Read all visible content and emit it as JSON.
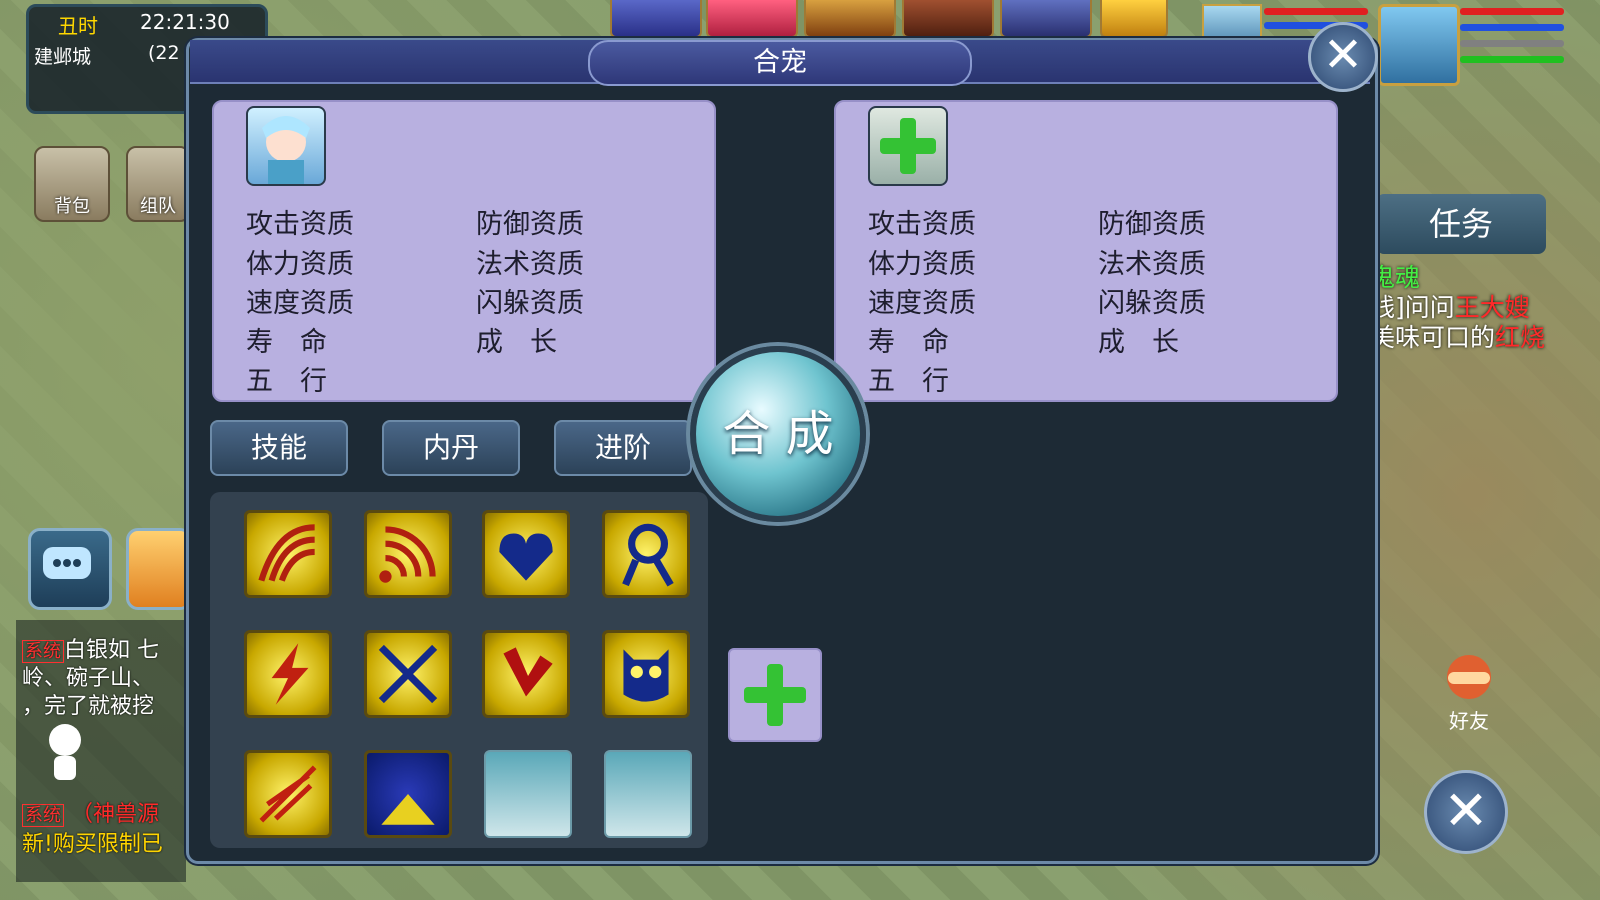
{
  "status": {
    "shichen": "丑时",
    "clock": "22:21:30",
    "city": "建邺城",
    "coord": "(22"
  },
  "side_buttons": {
    "bag": "背包",
    "team": "组队"
  },
  "panel": {
    "title": "合宠",
    "left_attrs": [
      "攻击资质",
      "防御资质",
      "体力资质",
      "法术资质",
      "速度资质",
      "闪躲资质",
      "寿　命",
      "成　长",
      "五　行"
    ],
    "right_attrs": [
      "攻击资质",
      "防御资质",
      "体力资质",
      "法术资质",
      "速度资质",
      "闪躲资质",
      "寿　命",
      "成　长",
      "五　行"
    ],
    "tabs": [
      "技能",
      "内丹",
      "进阶"
    ],
    "combine_label": "合 成",
    "skill_icons": [
      "claw-skill-icon",
      "sonic-wave-skill-icon",
      "heart-shield-skill-icon",
      "summon-skill-icon",
      "lightning-skill-icon",
      "crossed-weapons-skill-icon",
      "wound-skill-icon",
      "owl-skill-icon",
      "fire-strike-skill-icon",
      "night-skill-icon",
      "empty",
      "empty"
    ]
  },
  "right_hud": {
    "task_tab": "任务",
    "quest_lines": [
      {
        "text": "鬼魂",
        "color": "#44ee44"
      },
      {
        "prefix": "线]问问",
        "highlight": "王大嫂"
      },
      {
        "prefix": "美味可口的",
        "highlight": "红烧"
      }
    ],
    "friend_label": "好友"
  },
  "chat": {
    "line1_tag": "系统",
    "line1_text": "白银如 七",
    "line2_text": "岭、碗子山、",
    "line3_text": "，完了就被挖",
    "line4_tag": "系统",
    "line4_text": "（神兽源",
    "line5_text": "新!购买限制已"
  },
  "colors": {
    "accent": "#6d8aa8",
    "attr_panel": "#b8b0e0",
    "skill_gold": "#e8d020",
    "combine": "#6fc4cf"
  }
}
